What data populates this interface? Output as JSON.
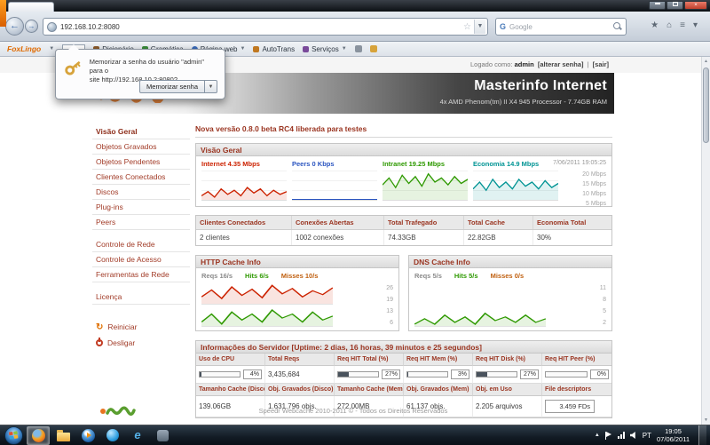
{
  "browser": {
    "urlbar": {
      "value": "192.168.10.2:8080"
    },
    "search": {
      "placeholder": "Google"
    },
    "foxlingo": {
      "brand": "FoxLingo",
      "items": [
        "Dicionário",
        "Gramática",
        "Página web",
        "AutoTrans",
        "Serviços"
      ]
    },
    "password_popup": {
      "line1": "Memorizar a senha do usuário \"admin\" para o",
      "line2": "site http://192.168.10.2:8080?",
      "button": "Memorizar senha"
    }
  },
  "page": {
    "login": {
      "prefix": "Logado como:",
      "user": "admin",
      "change_password": "[alterar senha]",
      "sep": "|",
      "logout": "[sair]"
    },
    "header": {
      "title": "Masterinfo Internet",
      "subtitle": "4x AMD Phenom(tm) II X4 945 Processor - 7.74GB RAM"
    },
    "sidebar": {
      "items": [
        "Visão Geral",
        "Objetos Gravados",
        "Objetos Pendentes",
        "Clientes Conectados",
        "Discos",
        "Plug-ins",
        "Peers",
        "Controle de Rede",
        "Controle de Acesso",
        "Ferramentas de Rede",
        "Licença"
      ],
      "actions": [
        "Reiniciar",
        "Desligar"
      ]
    },
    "notice": "Nova versão 0.8.0 beta RC4 liberada para testes",
    "overview": {
      "title": "Visão Geral",
      "timestamp": "7/06/2011 19:05:25",
      "series": [
        {
          "name": "Internet",
          "value": "4.35 Mbps"
        },
        {
          "name": "Peers",
          "value": "0 Kbps"
        },
        {
          "name": "Intranet",
          "value": "19.25 Mbps"
        },
        {
          "name": "Economia",
          "value": "14.9 Mbps"
        }
      ],
      "axis": [
        "20 Mbps",
        "15 Mbps",
        "10 Mbps",
        "5 Mbps"
      ],
      "charts": {
        "internet": [
          3,
          6,
          2,
          8,
          4,
          7,
          3,
          9,
          5,
          8,
          3,
          7,
          4,
          6
        ],
        "peers": [
          0.2,
          0.2,
          0.2,
          0.2,
          0.2,
          0.2,
          0.2,
          0.2,
          0.2,
          0.2
        ],
        "intranet": [
          11,
          16,
          9,
          18,
          12,
          17,
          10,
          19,
          13,
          16,
          11,
          17,
          12,
          15
        ],
        "economia": [
          8,
          13,
          7,
          15,
          9,
          13,
          8,
          15,
          10,
          13,
          8,
          14,
          9,
          12
        ]
      }
    },
    "stats": {
      "headers": [
        "Clientes Conectados",
        "Conexões Abertas",
        "Total Trafegado",
        "Total Cache",
        "Economia Total"
      ],
      "values": [
        "2 clientes",
        "1002 conexões",
        "74.33GB",
        "22.82GB",
        "30%"
      ]
    },
    "http_cache": {
      "title": "HTTP Cache Info",
      "metrics": [
        {
          "label": "Reqs",
          "value": "16/s"
        },
        {
          "label": "Hits",
          "value": "6/s"
        },
        {
          "label": "Misses",
          "value": "10/s"
        }
      ],
      "axis": [
        "26",
        "19",
        "13",
        "6"
      ],
      "charts": {
        "reqs": [
          9,
          18,
          7,
          22,
          11,
          19,
          8,
          24,
          13,
          20,
          9,
          17,
          12,
          21
        ],
        "hits": [
          2,
          6,
          1,
          7,
          3,
          6,
          2,
          8,
          4,
          6,
          2,
          7,
          3,
          5
        ]
      }
    },
    "dns_cache": {
      "title": "DNS Cache Info",
      "metrics": [
        {
          "label": "Reqs",
          "value": "5/s"
        },
        {
          "label": "Hits",
          "value": "5/s"
        },
        {
          "label": "Misses",
          "value": "0/s"
        }
      ],
      "axis": [
        "11",
        "8",
        "5",
        "2"
      ],
      "charts": {
        "hits": [
          1,
          4,
          1,
          6,
          2,
          5,
          1,
          7,
          3,
          5,
          2,
          6,
          2,
          4
        ]
      }
    },
    "server_info": {
      "title": "Informações do Servidor [Uptime: 2 dias, 16 horas, 39 minutos e 25 segundos]",
      "row1_headers": [
        "Uso de CPU",
        "Total Reqs",
        "Req HIT Total (%)",
        "Req HIT Mem (%)",
        "Req HIT Disk (%)",
        "Req HIT Peer (%)"
      ],
      "row1_values": [
        "4%",
        "3,435,684",
        "27%",
        "3%",
        "27%",
        "0%"
      ],
      "row1_bars": [
        4,
        0,
        27,
        3,
        27,
        0
      ],
      "row2_headers": [
        "Tamanho Cache (Disco)",
        "Obj. Gravados (Disco)",
        "Tamanho Cache (Mem)",
        "Obj. Gravados (Mem)",
        "Obj. em Uso",
        "File descriptors"
      ],
      "row2_values": [
        "139.06GB",
        "1.631.796 objs.",
        "272.00MB",
        "61.137 objs.",
        "2.205 arquivos",
        "3.459 FDs"
      ]
    },
    "footer": "Speedr Webcache 2010-2011 © - Todos os Direitos Reservados"
  },
  "taskbar": {
    "language": "PT",
    "time": "19:05",
    "date": "07/06/2011"
  }
}
